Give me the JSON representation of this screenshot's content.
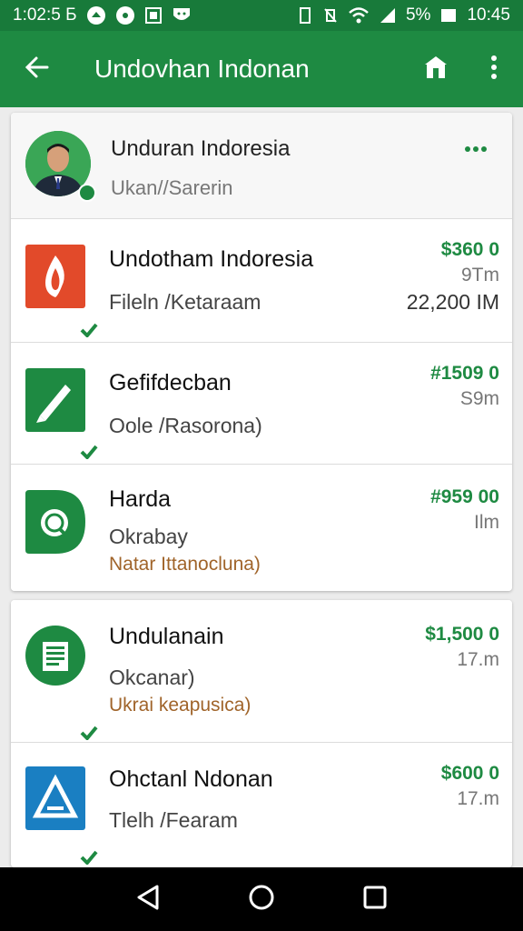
{
  "status_bar": {
    "time_left": "1:02:5 Б",
    "battery": "5%",
    "time_right": "10:45"
  },
  "app_bar": {
    "title": "Undovhan Indonan",
    "back_icon": "arrow-left-icon",
    "store_icon": "store-icon",
    "menu_icon": "more-vert-icon"
  },
  "profile": {
    "name": "Unduran Indoresia",
    "subtitle": "Ukan//Sarerin",
    "more_icon": "more-horiz-icon"
  },
  "items": [
    {
      "title": "Undotham Indoresia",
      "subtitle": "Fileln /Ketaraam",
      "amount": "$360 0",
      "meta": "9Tm",
      "meta2": "22,200 IM",
      "icon": "flame-icon",
      "icon_color": "#e24a2a"
    },
    {
      "title": "Gefifdecban",
      "subtitle": "Oole /Rasorona)",
      "amount": "#1509 0",
      "meta": "S9m",
      "icon": "pencil-icon",
      "icon_color": "#1e8a42"
    },
    {
      "title": "Harda",
      "subtitle": "Okrabay",
      "note": "Natar Ittanocluna)",
      "amount": "#959 00",
      "meta": "Ilm",
      "icon": "search-icon",
      "icon_color": "#1e8a42"
    },
    {
      "title": "Undulanain",
      "subtitle": "Okcanar)",
      "note": "Ukrai keapusica)",
      "amount": "$1,500 0",
      "meta": "17.m",
      "icon": "document-icon",
      "icon_color": "#1e8a42"
    },
    {
      "title": "Ohctanl Ndonan",
      "subtitle": "Tlelh /Fearam",
      "amount": "$600 0",
      "meta": "17.m",
      "icon": "triangle-logo-icon",
      "icon_color": "#1a7fc2"
    }
  ],
  "colors": {
    "primary": "#1e8a42",
    "status": "#187a3a"
  }
}
